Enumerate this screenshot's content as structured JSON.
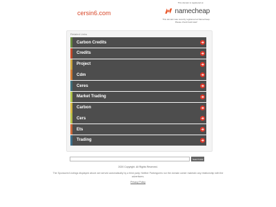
{
  "header": {
    "domain": "cersin6.com",
    "registered_text": "This domain is registered at",
    "registrar_name": "namecheap",
    "registrar_note": "This domain was recently registered at Namecheap. Please check back later!"
  },
  "related": {
    "title": "Related Links",
    "arrow_icon": "right-arrow-circle-icon",
    "arrow_color": "#e0392b",
    "row_color": "#4d4d4d",
    "items": [
      {
        "label": "Carbon Credits",
        "stripe": "#6a8b3e"
      },
      {
        "label": "Credits",
        "stripe": "#c24a2a"
      },
      {
        "label": "Project",
        "stripe": "#cda53f"
      },
      {
        "label": "Cdm",
        "stripe": "#d07a33"
      },
      {
        "label": "Ceres",
        "stripe": "#3f6f7a"
      },
      {
        "label": "Market Trading",
        "stripe": "#aec44a"
      },
      {
        "label": "Carbon",
        "stripe": "#d6b940"
      },
      {
        "label": "Cers",
        "stripe": "#b9c24a"
      },
      {
        "label": "Ets",
        "stripe": "#cf6a3a"
      },
      {
        "label": "Trading",
        "stripe": "#3c6f8a"
      }
    ]
  },
  "search": {
    "placeholder": "",
    "button_label": "Search Ads"
  },
  "footer": {
    "copyright": "2020 Copyright. All Rights Reserved.",
    "disclaimer": "The Sponsored Listings displayed above are served automatically by a third party. Neither Parkingcrew nor the domain owner maintain any relationship with the advertisers.",
    "privacy_label": "Privacy Policy"
  }
}
